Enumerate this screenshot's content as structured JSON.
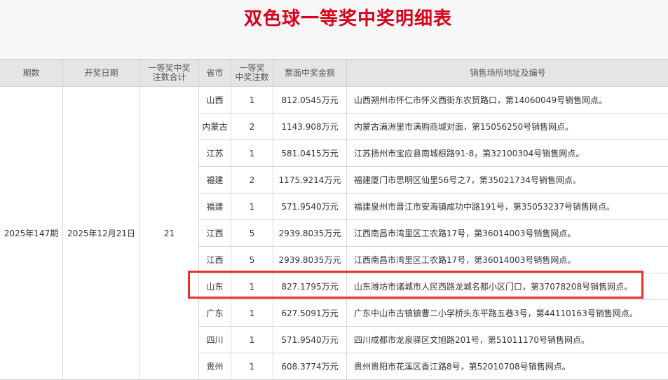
{
  "page": {
    "title": "双色球一等奖中奖明细表"
  },
  "table": {
    "headers": {
      "period": "期数",
      "draw_date": "开奖日期",
      "total_bets_line1": "一等奖中奖",
      "total_bets_line2": "注数合计",
      "province": "省市",
      "bets_line1": "一等奖",
      "bets_line2": "中奖注数",
      "amount": "票面中奖金额",
      "address": "销售场所地址及编号"
    },
    "period": "2025年147期",
    "draw_date": "2025年12月21日",
    "total_bets": "21",
    "rows": [
      {
        "province": "山西",
        "bets": "1",
        "amount": "812.0545万元",
        "address": "山西朔州市怀仁市怀义西街东农贸路口，第14060049号销售网点。"
      },
      {
        "province": "内蒙古",
        "bets": "2",
        "amount": "1143.908万元",
        "address": "内蒙古满洲里市满购商城对面，第15056250号销售网点。"
      },
      {
        "province": "江苏",
        "bets": "1",
        "amount": "581.0415万元",
        "address": "江苏扬州市宝应县南城根路91-8，第32100304号销售网点。"
      },
      {
        "province": "福建",
        "bets": "2",
        "amount": "1175.9214万元",
        "address": "福建厦门市思明区仙里56号之7，第35021734号销售网点。"
      },
      {
        "province": "福建",
        "bets": "1",
        "amount": "571.9540万元",
        "address": "福建泉州市晋江市安海镇成功中路191号，第35053237号销售网点。"
      },
      {
        "province": "江西",
        "bets": "5",
        "amount": "2939.8035万元",
        "address": "江西南昌市湾里区工农路17号，第36014003号销售网点。"
      },
      {
        "province": "江西",
        "bets": "5",
        "amount": "2939.8035万元",
        "address": "江西南昌市湾里区工农路17号，第36014003号销售网点。"
      },
      {
        "province": "山东",
        "bets": "1",
        "amount": "827.1795万元",
        "address": "山东潍坊市诸城市人民西路龙城名都小区门口，第37078208号销售网点。"
      },
      {
        "province": "广东",
        "bets": "1",
        "amount": "627.5091万元",
        "address": "广东中山市古镇镇曹二小学桥头东平路五巷3号，第44110163号销售网点。"
      },
      {
        "province": "四川",
        "bets": "1",
        "amount": "571.9540万元",
        "address": "四川成都市龙泉驿区文旭路201号，第51011170号销售网点。"
      },
      {
        "province": "贵州",
        "bets": "1",
        "amount": "608.3774万元",
        "address": "贵州贵阳市花溪区香江路8号，第52010708号销售网点。"
      }
    ]
  },
  "colors": {
    "title": "#d9001b",
    "header_bg": "#e5e5e5",
    "highlight": "#e8322f"
  }
}
